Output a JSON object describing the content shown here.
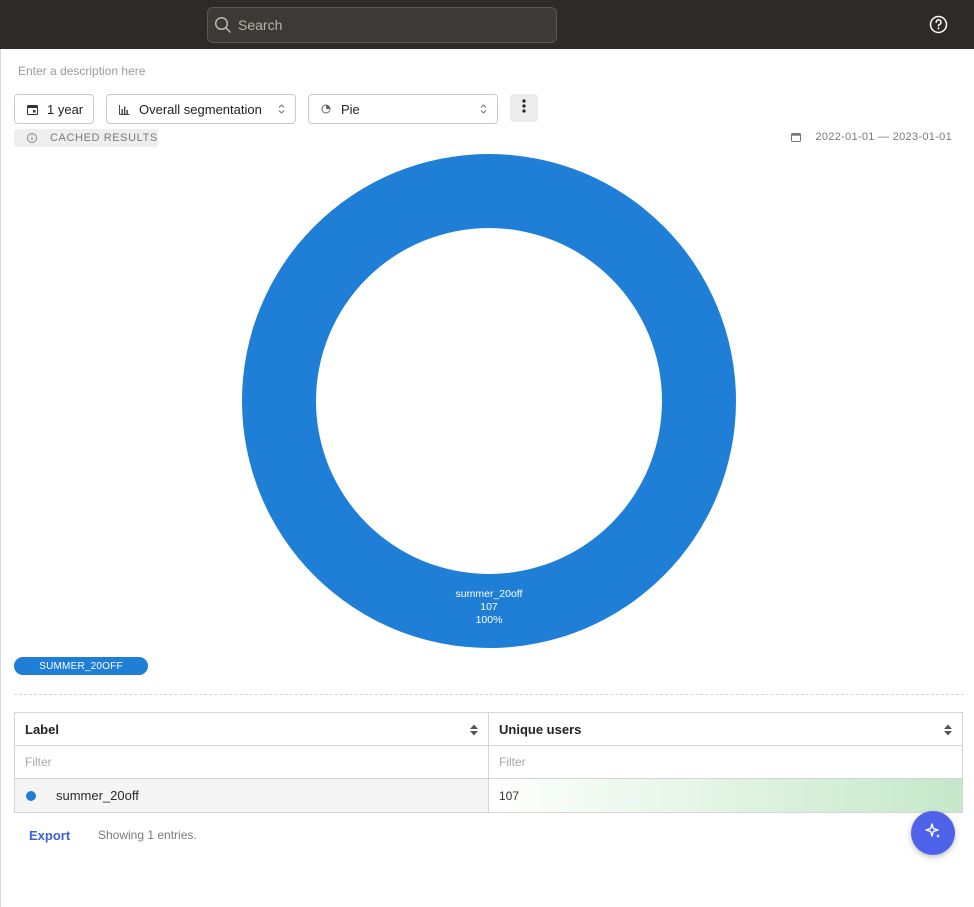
{
  "topbar": {
    "search_placeholder": "Search",
    "search_icon": "search-icon",
    "help_icon": "help-circle-icon"
  },
  "description_placeholder": "Enter a description here",
  "controls": {
    "date_range": {
      "label": "1 year",
      "icon": "calendar-icon"
    },
    "segmentation": {
      "label": "Overall segmentation",
      "icon": "bar-chart-icon"
    },
    "chart_type": {
      "label": "Pie",
      "icon": "pie-chart-icon"
    },
    "more_icon": "vertical-ellipsis-icon"
  },
  "cached_badge": {
    "label": "CACHED RESULTS",
    "icon": "info-circle-icon"
  },
  "date_range_text": "2022-01-01 — 2023-01-01",
  "colors": {
    "series": "#1f7ed6",
    "accent": "#4f63ea",
    "topbar": "#2e2a28"
  },
  "chart_data": {
    "type": "pie",
    "donut": true,
    "slices": [
      {
        "label": "summer_20off",
        "value": 107,
        "percent_label": "100%",
        "color": "#1f7ed6"
      }
    ],
    "legend": [
      "SUMMER_20OFF"
    ],
    "legend_position": "bottom-left"
  },
  "table": {
    "columns": [
      "Label",
      "Unique users"
    ],
    "filter_placeholders": [
      "Filter",
      "Filter"
    ],
    "rows": [
      {
        "label": "summer_20off",
        "value": "107"
      }
    ]
  },
  "footer": {
    "export_label": "Export",
    "showing_text": "Showing 1 entries."
  },
  "fab_icon": "sparkle-icon"
}
